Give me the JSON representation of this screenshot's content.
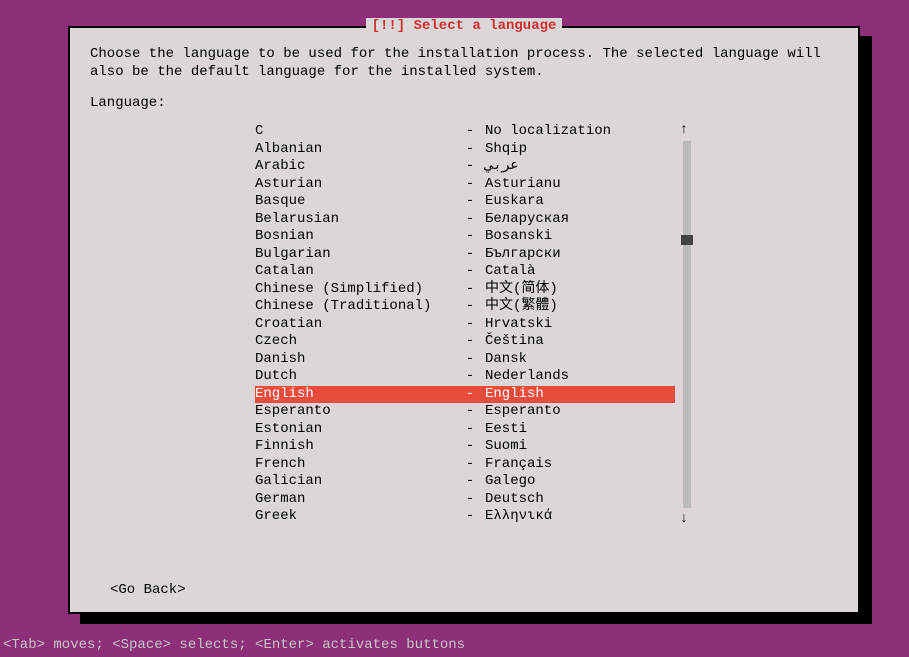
{
  "dialog": {
    "title": "[!!] Select a language",
    "description": "Choose the language to be used for the installation process. The selected language will also be the default language for the installed system.",
    "label": "Language:",
    "goBack": "<Go Back>"
  },
  "languages": [
    {
      "name": "C",
      "native": "No localization",
      "selected": false
    },
    {
      "name": "Albanian",
      "native": "Shqip",
      "selected": false
    },
    {
      "name": "Arabic",
      "native": "عربي",
      "selected": false
    },
    {
      "name": "Asturian",
      "native": "Asturianu",
      "selected": false
    },
    {
      "name": "Basque",
      "native": "Euskara",
      "selected": false
    },
    {
      "name": "Belarusian",
      "native": "Беларуская",
      "selected": false
    },
    {
      "name": "Bosnian",
      "native": "Bosanski",
      "selected": false
    },
    {
      "name": "Bulgarian",
      "native": "Български",
      "selected": false
    },
    {
      "name": "Catalan",
      "native": "Català",
      "selected": false
    },
    {
      "name": "Chinese (Simplified)",
      "native": "中文(简体)",
      "selected": false
    },
    {
      "name": "Chinese (Traditional)",
      "native": "中文(繁體)",
      "selected": false
    },
    {
      "name": "Croatian",
      "native": "Hrvatski",
      "selected": false
    },
    {
      "name": "Czech",
      "native": "Čeština",
      "selected": false
    },
    {
      "name": "Danish",
      "native": "Dansk",
      "selected": false
    },
    {
      "name": "Dutch",
      "native": "Nederlands",
      "selected": false
    },
    {
      "name": "English",
      "native": "English",
      "selected": true
    },
    {
      "name": "Esperanto",
      "native": "Esperanto",
      "selected": false
    },
    {
      "name": "Estonian",
      "native": "Eesti",
      "selected": false
    },
    {
      "name": "Finnish",
      "native": "Suomi",
      "selected": false
    },
    {
      "name": "French",
      "native": "Français",
      "selected": false
    },
    {
      "name": "Galician",
      "native": "Galego",
      "selected": false
    },
    {
      "name": "German",
      "native": "Deutsch",
      "selected": false
    },
    {
      "name": "Greek",
      "native": "Ελληνικά",
      "selected": false
    }
  ],
  "separator": "-",
  "scroll": {
    "up": "↑",
    "down": "↓"
  },
  "helpBar": "<Tab> moves; <Space> selects; <Enter> activates buttons"
}
